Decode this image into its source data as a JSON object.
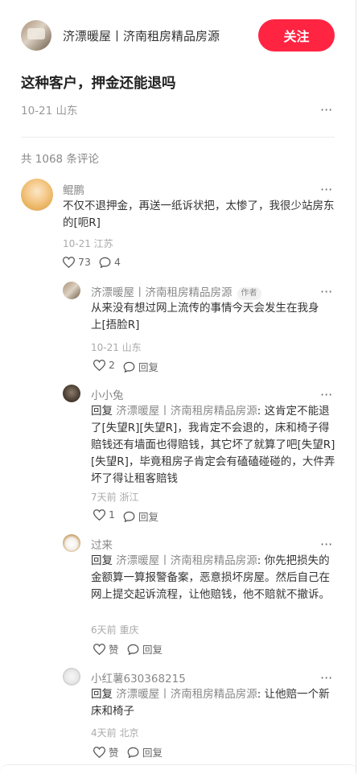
{
  "header": {
    "author": "济漂暖屋丨济南租房精品房源",
    "follow_label": "关注"
  },
  "post": {
    "title": "这种客户，押金还能退吗",
    "meta": "10-21 山东",
    "more": "···"
  },
  "comments_header": {
    "count_text": "共 1068 条评论"
  },
  "comments": [
    {
      "name": "鲲鹏",
      "text": "不仅不退押金，再送一纸诉状把，太惨了，我很少站房东的[呃R]",
      "meta": "10-21 江苏",
      "likes": "73",
      "replies": "4",
      "more": "···"
    }
  ],
  "replies": [
    {
      "name": "济漂暖屋丨济南租房精品房源",
      "badge": "作者",
      "text": "从来没有想过网上流传的事情今天会发生在我身上[捂脸R]",
      "meta": "10-21 山东",
      "likes": "2",
      "reply_label": "回复",
      "more": "···"
    },
    {
      "name": "小小兔",
      "reply_prefix": "回复",
      "reply_to": "济漂暖屋丨济南租房精品房源",
      "text": ": 这肯定不能退了[失望R][失望R]，我肯定不会退的，床和椅子得赔钱还有墙面也得赔钱，其它坏了就算了吧[失望R][失望R]，毕竟租房子肯定会有磕磕碰碰的，大件弄坏了得让租客赔钱",
      "meta": "7天前 浙江",
      "likes": "1",
      "reply_label": "回复",
      "more": "···"
    },
    {
      "name": "过来",
      "reply_prefix": "回复",
      "reply_to": "济漂暖屋丨济南租房精品房源",
      "text": ": 你先把损失的金额算一算报警备案，恶意损坏房屋。然后自己在网上提交起诉流程，让他赔钱，他不赔就不撤诉。",
      "meta": "6天前 重庆",
      "likes": "赞",
      "reply_label": "回复",
      "more": "···"
    },
    {
      "name": "小红薯630368215",
      "reply_prefix": "回复",
      "reply_to": "济漂暖屋丨济南租房精品房源",
      "text": ": 让他赔一个新床和椅子",
      "meta": "4天前 北京",
      "likes": "赞",
      "reply_label": "回复",
      "more": "···"
    }
  ],
  "colors": {
    "accent": "#ff2442",
    "muted": "#999999",
    "text": "#333333"
  }
}
